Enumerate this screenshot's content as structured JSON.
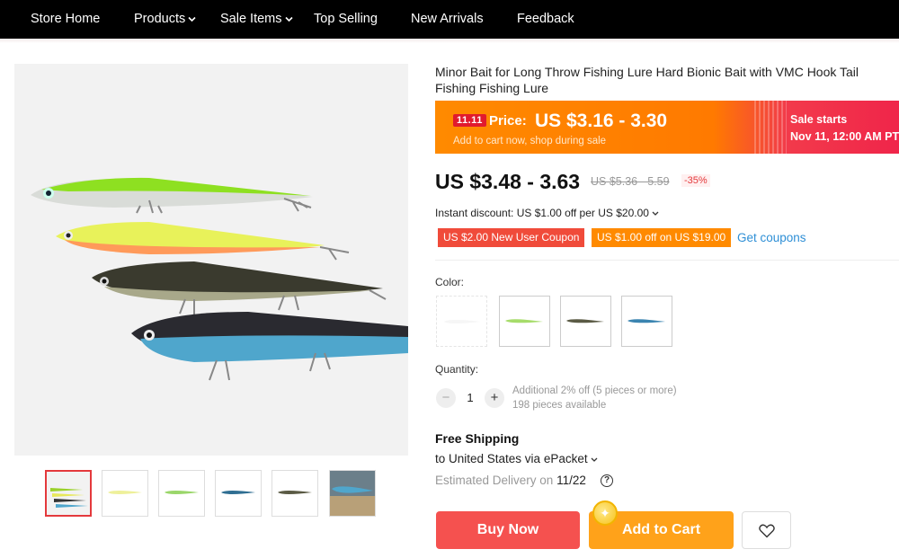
{
  "nav": {
    "items": [
      {
        "label": "Store Home",
        "dropdown": false
      },
      {
        "label": "Products",
        "dropdown": true
      },
      {
        "label": "Sale Items",
        "dropdown": true
      },
      {
        "label": "Top Selling",
        "dropdown": false
      },
      {
        "label": "New Arrivals",
        "dropdown": false
      },
      {
        "label": "Feedback",
        "dropdown": false
      }
    ]
  },
  "product": {
    "title": "Minor Bait for Long Throw Fishing Lure Hard Bionic Bait with VMC Hook Tail Fishing Fishing Lure",
    "promo": {
      "tag": "11.11",
      "price_label": "Price:",
      "price": "US $3.16 - 3.30",
      "subtitle": "Add to cart now, shop during sale",
      "sale_starts_label": "Sale starts",
      "sale_starts_date": "Nov 11, 12:00 AM PT"
    },
    "price": "US $3.48 - 3.63",
    "original_price": "US $5.36 - 5.59",
    "discount": "-35%",
    "instant_discount": "Instant discount: US $1.00 off per US $20.00",
    "coupons": [
      "US $2.00 New User Coupon",
      "US $1.00 off on US $19.00"
    ],
    "get_coupons": "Get coupons",
    "color_label": "Color:",
    "colors": [
      "white",
      "green",
      "dark-olive",
      "blue"
    ],
    "quantity_label": "Quantity:",
    "quantity": "1",
    "quantity_note": "Additional 2% off (5 pieces or more)",
    "available": "198 pieces available",
    "shipping": {
      "title": "Free Shipping",
      "to": "to United States via ePacket",
      "est_prefix": "Estimated Delivery on",
      "est_date": "11/22"
    },
    "buttons": {
      "buy": "Buy Now",
      "cart": "Add to Cart"
    },
    "colors_hex": {
      "accent": "#f5514f",
      "cart": "#ffa21a",
      "link": "#2e8fd6"
    }
  }
}
